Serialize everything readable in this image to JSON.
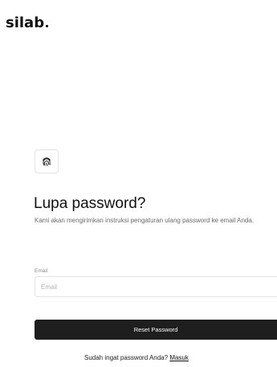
{
  "brand": {
    "logo_text": "silab"
  },
  "header": {
    "title": "Lupa password?",
    "subtitle": "Kami akan mengirimkan instruksi pengaturan ulang password ke email Anda."
  },
  "form": {
    "email_label": "Email",
    "email_placeholder": "Email",
    "email_value": "",
    "submit_label": "Reset Password"
  },
  "footer": {
    "prompt": "Sudah ingat password Anda?",
    "login_label": "Masuk"
  },
  "icons": {
    "feature_icon": "fingerprint-icon"
  }
}
